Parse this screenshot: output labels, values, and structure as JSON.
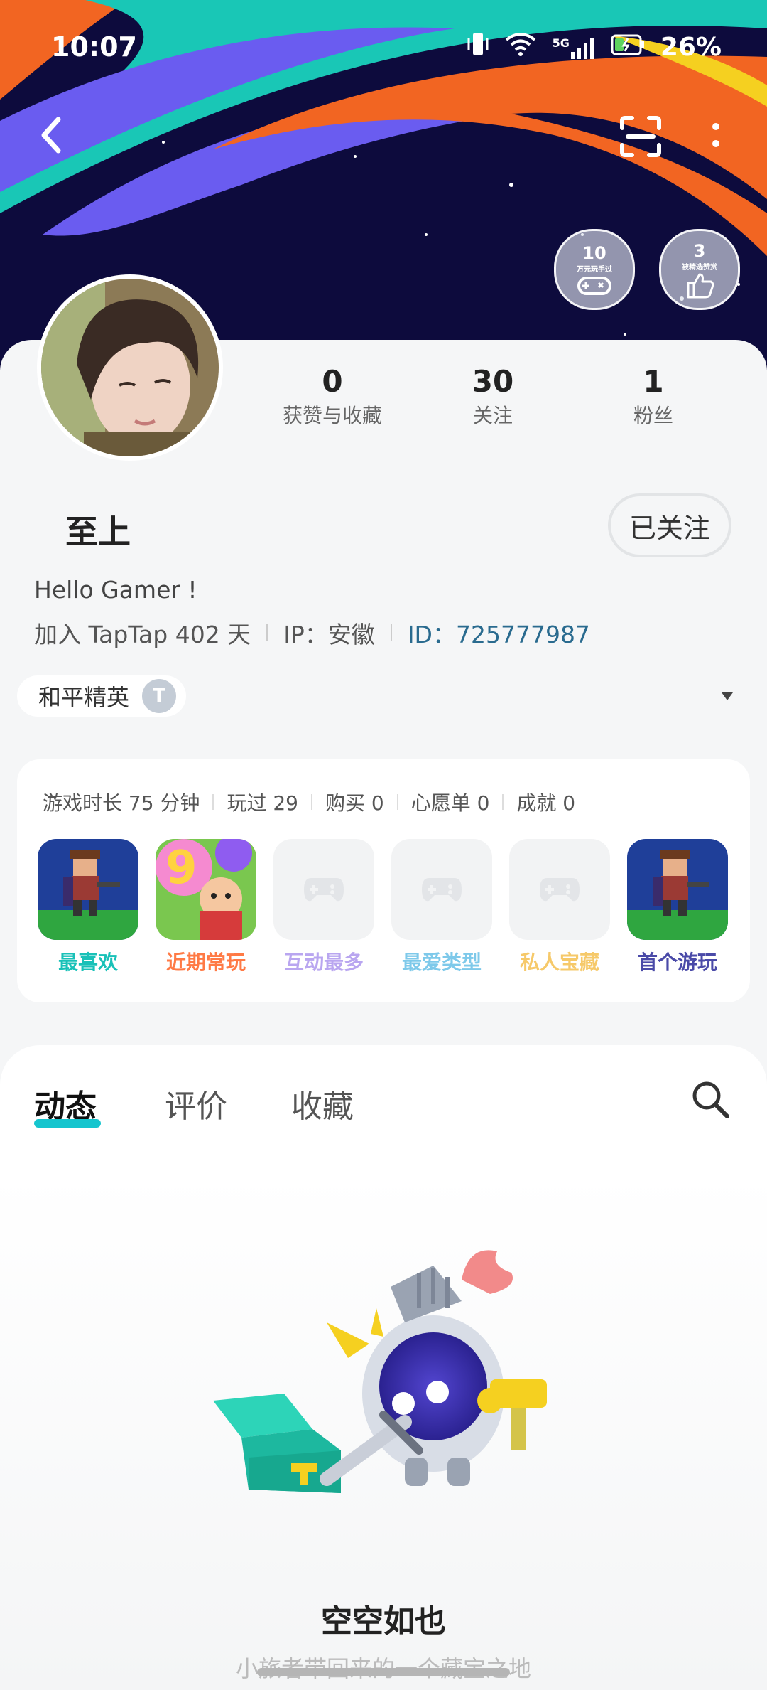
{
  "status_bar": {
    "time": "10:07",
    "signal": "5G",
    "battery": "26%"
  },
  "badges": [
    {
      "number": "10",
      "caption": "万元玩手过",
      "icon": "gamepad-icon"
    },
    {
      "number": "3",
      "caption": "被精选赞赏",
      "icon": "thumbs-up-icon"
    }
  ],
  "stats": [
    {
      "num": "0",
      "label": "获赞与收藏"
    },
    {
      "num": "30",
      "label": "关注"
    },
    {
      "num": "1",
      "label": "粉丝"
    }
  ],
  "profile": {
    "name": "至上",
    "follow_label": "已关注",
    "bio": "Hello Gamer !",
    "joined": "加入 TapTap 402 天",
    "ip": "IP：安徽",
    "id": "ID：725777987"
  },
  "game_tag": {
    "label": "和平精英"
  },
  "game_card": {
    "stats": [
      "游戏时长 75 分钟",
      "玩过 29",
      "购买 0",
      "心愿单 0",
      "成就 0"
    ],
    "tiles": [
      {
        "label": "最喜欢",
        "color": "#19c1b8",
        "kind": "pixel"
      },
      {
        "label": "近期常玩",
        "color": "#ff7a45",
        "kind": "colorful"
      },
      {
        "label": "互动最多",
        "color": "#b9a6f0",
        "kind": "empty"
      },
      {
        "label": "最爱类型",
        "color": "#7ec9ea",
        "kind": "empty"
      },
      {
        "label": "私人宝藏",
        "color": "#f6c96a",
        "kind": "empty"
      },
      {
        "label": "首个游玩",
        "color": "#4a4aa8",
        "kind": "pixel"
      }
    ]
  },
  "tabs": [
    "动态",
    "评价",
    "收藏"
  ],
  "empty_state": {
    "title": "空空如也",
    "subtitle": "小旅者带回来的一个藏宝之地"
  },
  "colors": {
    "accent": "#15c5ce",
    "id_link": "#2a6b8f",
    "banner_bg": "#0d0b3d"
  }
}
